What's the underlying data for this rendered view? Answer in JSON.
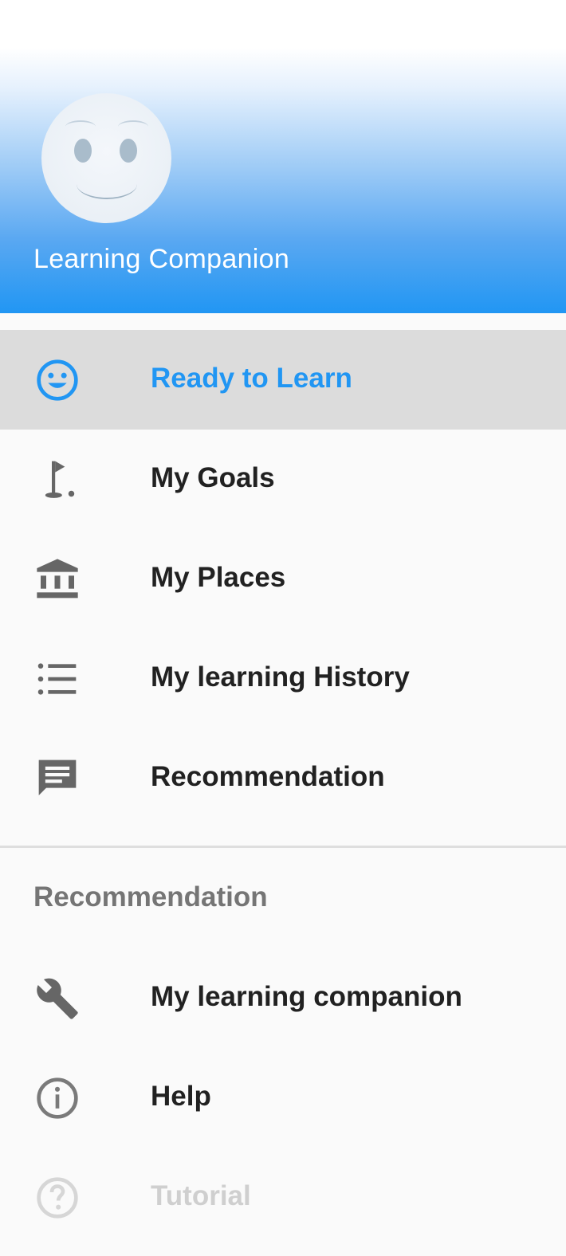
{
  "header": {
    "app_title": "Learning Companion",
    "avatar_icon": "smiley-face-avatar",
    "gradient_colors": [
      "#ffffff",
      "#2196f3"
    ]
  },
  "menu": {
    "items": [
      {
        "label": "Ready to Learn",
        "icon": "smiley-icon",
        "active": true
      },
      {
        "label": "My Goals",
        "icon": "golf-flag-icon"
      },
      {
        "label": "My Places",
        "icon": "institution-icon"
      },
      {
        "label": "My learning History",
        "icon": "list-icon"
      },
      {
        "label": "Recommendation",
        "icon": "message-icon"
      }
    ]
  },
  "section": {
    "title": "Recommendation",
    "items": [
      {
        "label": "My learning companion",
        "icon": "wrench-icon"
      },
      {
        "label": "Help",
        "icon": "info-icon"
      },
      {
        "label": "Tutorial",
        "icon": "help-circle-icon"
      }
    ]
  },
  "colors": {
    "accent": "#2196f3",
    "active_background": "#dcdcdc",
    "icon_gray": "#666666",
    "faded_text": "#cfcfcf"
  }
}
